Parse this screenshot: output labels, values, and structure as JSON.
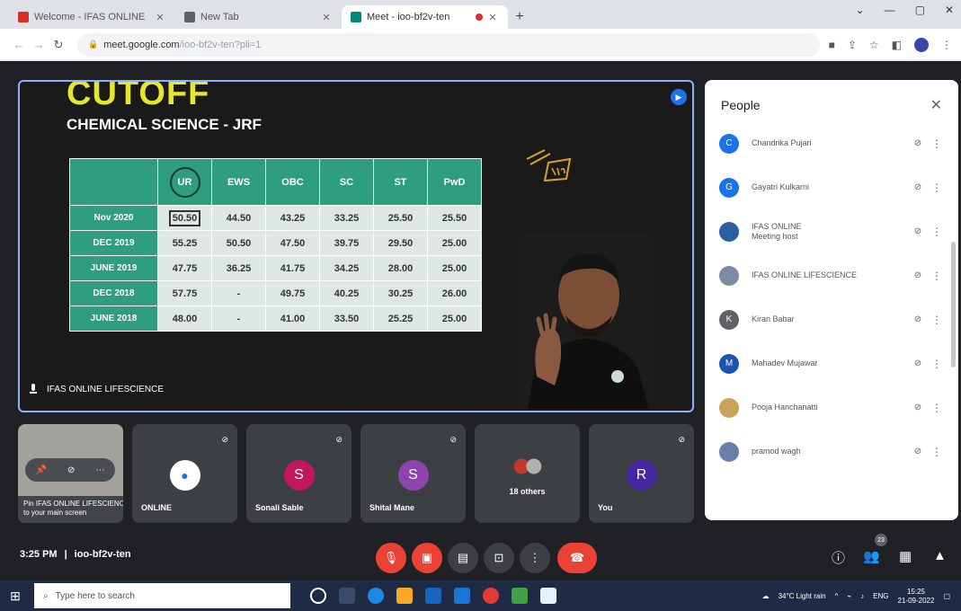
{
  "browser": {
    "tabs": [
      {
        "label": "Welcome - IFAS ONLINE",
        "favicon_color": "#d93025",
        "active": false
      },
      {
        "label": "New Tab",
        "favicon_color": "#5f6368",
        "active": false
      },
      {
        "label": "Meet - ioo-bf2v-ten",
        "favicon_color": "#00897b",
        "active": true
      }
    ],
    "url": "meet.google.com",
    "url_path": "/ioo-bf2v-ten?pli=1",
    "window_controls": [
      "⌄",
      "—",
      "▢",
      "✕"
    ]
  },
  "presentation": {
    "title": "CUTOFF",
    "subtitle": "CHEMICAL SCIENCE - JRF",
    "table": {
      "headers": [
        "UR",
        "EWS",
        "OBC",
        "SC",
        "ST",
        "PwD"
      ],
      "rows": [
        {
          "label": "Nov 2020",
          "values": [
            "50.50",
            "44.50",
            "43.25",
            "33.25",
            "25.50",
            "25.50"
          ]
        },
        {
          "label": "DEC 2019",
          "values": [
            "55.25",
            "50.50",
            "47.50",
            "39.75",
            "29.50",
            "25.00"
          ]
        },
        {
          "label": "JUNE 2019",
          "values": [
            "47.75",
            "36.25",
            "41.75",
            "34.25",
            "28.00",
            "25.00"
          ]
        },
        {
          "label": "DEC 2018",
          "values": [
            "57.75",
            "-",
            "49.75",
            "40.25",
            "30.25",
            "26.00"
          ]
        },
        {
          "label": "JUNE 2018",
          "values": [
            "48.00",
            "-",
            "41.00",
            "33.50",
            "25.25",
            "25.00"
          ]
        }
      ]
    },
    "presenter_name": "IFAS ONLINE LIFESCIENCE"
  },
  "people_panel": {
    "title": "People",
    "participants": [
      {
        "name": "Chandrika Pujari",
        "sub": "",
        "avatar_letter": "C",
        "avatar_color": "#1a73e8"
      },
      {
        "name": "Gayatri Kulkarni",
        "sub": "",
        "avatar_letter": "G",
        "avatar_color": "#1a73e8"
      },
      {
        "name": "IFAS ONLINE",
        "sub": "Meeting host",
        "avatar_letter": "",
        "avatar_color": "#2c5f9e"
      },
      {
        "name": "IFAS ONLINE LIFESCIENCE",
        "sub": "",
        "avatar_letter": "",
        "avatar_color": "#7b8ba3"
      },
      {
        "name": "Kiran Babar",
        "sub": "",
        "avatar_letter": "K",
        "avatar_color": "#5f6368"
      },
      {
        "name": "Mahadev Mujawar",
        "sub": "",
        "avatar_letter": "M",
        "avatar_color": "#1a56b0"
      },
      {
        "name": "Pooja Hanchanatti",
        "sub": "",
        "avatar_letter": "",
        "avatar_color": "#c8a45a"
      },
      {
        "name": "pramod wagh",
        "sub": "",
        "avatar_letter": "",
        "avatar_color": "#6a7fa8"
      }
    ]
  },
  "tiles": [
    {
      "name": "",
      "avatar_letter": "",
      "kind": "self"
    },
    {
      "name": "ONLINE",
      "avatar_letter": "",
      "avatar_color": "#1a73e8"
    },
    {
      "name": "Sonali Sable",
      "avatar_letter": "S",
      "avatar_color": "#c2185b"
    },
    {
      "name": "Shital Mane",
      "avatar_letter": "S",
      "avatar_color": "#8e44ad"
    },
    {
      "name": "18 others",
      "avatar_letter": "",
      "avatar_color": "#c0392b"
    },
    {
      "name": "You",
      "avatar_letter": "R",
      "avatar_color": "#4527a0"
    }
  ],
  "pin_popup": {
    "line1": "Pin IFAS ONLINE LIFESCIENCE",
    "line2": "to your main screen"
  },
  "controls": {
    "time": "3:25 PM",
    "meeting_code": "ioo-bf2v-ten",
    "people_count": "23"
  },
  "taskbar": {
    "search_placeholder": "Type here to search",
    "weather": "34°C Light rain",
    "language": "ENG",
    "time": "15:25",
    "date": "21-09-2022"
  }
}
